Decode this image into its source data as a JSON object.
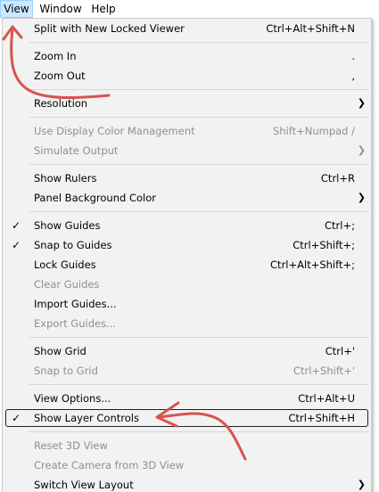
{
  "menubar": {
    "items": [
      "View",
      "Window",
      "Help"
    ],
    "active": "View"
  },
  "menu": {
    "rows": [
      {
        "kind": "item",
        "label": "Split with New Locked Viewer",
        "shortcut": "Ctrl+Alt+Shift+N"
      },
      {
        "kind": "sep"
      },
      {
        "kind": "item",
        "label": "Zoom In",
        "shortcut": "."
      },
      {
        "kind": "item",
        "label": "Zoom Out",
        "shortcut": ","
      },
      {
        "kind": "sep"
      },
      {
        "kind": "item",
        "label": "Resolution",
        "submenu": true
      },
      {
        "kind": "sep"
      },
      {
        "kind": "item",
        "label": "Use Display Color Management",
        "shortcut": "Shift+Numpad /",
        "disabled": true
      },
      {
        "kind": "item",
        "label": "Simulate Output",
        "submenu": true,
        "disabled": true
      },
      {
        "kind": "sep"
      },
      {
        "kind": "item",
        "label": "Show Rulers",
        "shortcut": "Ctrl+R"
      },
      {
        "kind": "item",
        "label": "Panel Background Color",
        "submenu": true
      },
      {
        "kind": "sep"
      },
      {
        "kind": "item",
        "label": "Show Guides",
        "shortcut": "Ctrl+;",
        "checked": true
      },
      {
        "kind": "item",
        "label": "Snap to Guides",
        "shortcut": "Ctrl+Shift+;",
        "checked": true
      },
      {
        "kind": "item",
        "label": "Lock Guides",
        "shortcut": "Ctrl+Alt+Shift+;"
      },
      {
        "kind": "item",
        "label": "Clear Guides",
        "disabled": true
      },
      {
        "kind": "item",
        "label": "Import Guides..."
      },
      {
        "kind": "item",
        "label": "Export Guides...",
        "disabled": true
      },
      {
        "kind": "sep"
      },
      {
        "kind": "item",
        "label": "Show Grid",
        "shortcut": "Ctrl+'"
      },
      {
        "kind": "item",
        "label": "Snap to Grid",
        "shortcut": "Ctrl+Shift+'",
        "disabled": true
      },
      {
        "kind": "sep"
      },
      {
        "kind": "item",
        "label": "View Options...",
        "shortcut": "Ctrl+Alt+U"
      },
      {
        "kind": "item",
        "label": "Show Layer Controls",
        "shortcut": "Ctrl+Shift+H",
        "checked": true,
        "highlighted": true
      },
      {
        "kind": "sep"
      },
      {
        "kind": "item",
        "label": "Reset 3D View",
        "disabled": true
      },
      {
        "kind": "item",
        "label": "Create Camera from 3D View",
        "disabled": true
      },
      {
        "kind": "item",
        "label": "Switch View Layout",
        "submenu": true
      }
    ]
  },
  "glyphs": {
    "check": "✓",
    "submenu_arrow": "❯"
  },
  "colors": {
    "menu_background": "#f2f2f2",
    "active_menubar_bg": "#cce8ff",
    "disabled_text": "#8f8f8f",
    "annotation_arrow": "#d9534f"
  }
}
